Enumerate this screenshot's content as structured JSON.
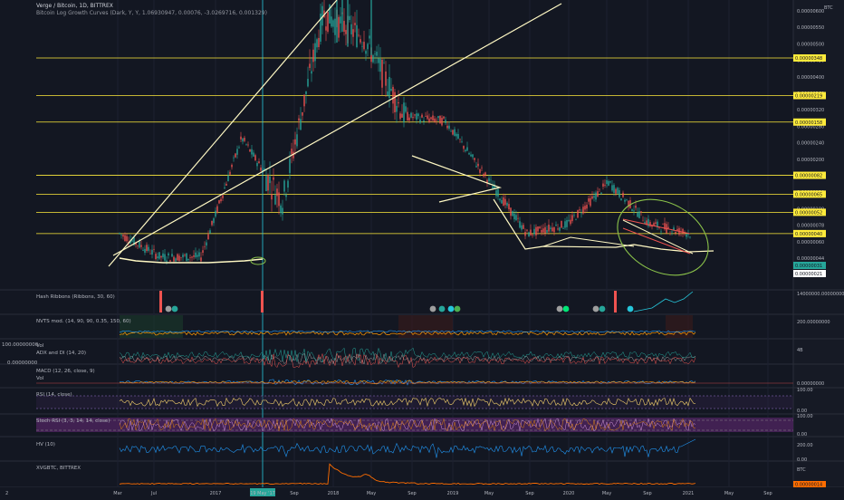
{
  "header": {
    "symbol": "Verge / Bitcoin, 1D, BITTREX",
    "indicator": "Bitcoin Log Growth Curves (Dark, Y, Y, 1.06930947, 0.00076, -3.0269716, 0.001329)",
    "currency": "BTC"
  },
  "panels": [
    {
      "name": "hash-ribbons",
      "label": "Hash Ribbons (Ribbons, 30, 60)",
      "right_value": "14000000.00000000"
    },
    {
      "name": "nvts",
      "label": "NVTS mod. (14, 90, 90, 0.35, 150, 60)",
      "right_value": "200.00000000"
    },
    {
      "name": "vol-adx",
      "label": "Vol",
      "label2": "ADX and DI (14, 20)",
      "left_top": "100.00000000",
      "left_bottom": "0.00000000",
      "right_value": "4B"
    },
    {
      "name": "macd",
      "label": "MACD (12, 26, close, 9)",
      "label2": "Vol",
      "right_value": "0.00000000"
    },
    {
      "name": "rsi",
      "label": "RSI (14, close)",
      "right_top": "100.00",
      "right_bottom": "0.00"
    },
    {
      "name": "stoch-rsi",
      "label": "Stoch RSI (3, 3, 14, 14, close)",
      "right_top": "100.00",
      "right_bottom": "0.00"
    },
    {
      "name": "hv",
      "label": "HV (10)",
      "right_top": "200.00",
      "right_bottom": "0.00"
    },
    {
      "name": "xvgbtc",
      "label": "XVGBTC, BITTREX",
      "right_top": "BTC",
      "right_bottom": "0.00000014"
    }
  ],
  "price_axis": {
    "ticks": [
      "0.00000600",
      "0.00000550",
      "0.00000500",
      "0.00000450",
      "0.00000400",
      "0.00000360",
      "0.00000320",
      "0.00000280",
      "0.00000240",
      "0.00000200",
      "0.00000160",
      "0.00000130",
      "0.00000100",
      "0.00000078",
      "0.00000060",
      "0.00000044"
    ],
    "badges": [
      {
        "text": "0.00000348",
        "color": "#ffeb3b"
      },
      {
        "text": "0.00000219",
        "color": "#ffeb3b"
      },
      {
        "text": "0.00000158",
        "color": "#ffeb3b"
      },
      {
        "text": "0.00000082",
        "color": "#ffeb3b"
      },
      {
        "text": "0.00000065",
        "color": "#ffeb3b"
      },
      {
        "text": "0.00000052",
        "color": "#ffeb3b"
      },
      {
        "text": "0.00000040",
        "color": "#ffeb3b"
      },
      {
        "text": "0.00000031",
        "color": "#26a69a"
      },
      {
        "text": "0.00000021",
        "color": "#ffffff"
      }
    ]
  },
  "time_axis": {
    "labels": [
      "Mar",
      "Jul",
      "2017",
      "19 May '17",
      "Sep",
      "2018",
      "May",
      "Sep",
      "2019",
      "May",
      "Sep",
      "2020",
      "May",
      "Sep",
      "2021",
      "May",
      "Sep"
    ],
    "highlight": "19 May '17",
    "corner_label": "2"
  },
  "colors": {
    "background": "#131722",
    "up": "#26a69a",
    "down": "#ef5350",
    "level_line": "#ffeb3b",
    "trend_line": "#fff9c4",
    "ellipse": "#8bc34a",
    "rsi": "#f5d36b",
    "stoch": "#9c27b0",
    "hv": "#2196f3",
    "xvg": "#ff6d00"
  },
  "chart_data": {
    "type": "line",
    "title": "Verge / Bitcoin, 1D, BITTREX",
    "xlabel": "",
    "ylabel": "",
    "scale": "log",
    "x": [
      "2016-03",
      "2016-07",
      "2017-01",
      "2017-05",
      "2017-09",
      "2018-01",
      "2018-05",
      "2018-09",
      "2019-01",
      "2019-05",
      "2019-09",
      "2020-01",
      "2020-05",
      "2020-09",
      "2021-01"
    ],
    "values": [
      4e-07,
      3e-07,
      3e-07,
      1.3e-06,
      6e-07,
      6e-06,
      4.5e-06,
      1.7e-06,
      1.6e-06,
      8e-07,
      4e-07,
      4.5e-07,
      7.5e-07,
      4.5e-07,
      4e-07
    ],
    "levels": [
      3.48e-06,
      2.19e-06,
      1.58e-06,
      8.2e-07,
      6.5e-07,
      5.2e-07,
      4e-07
    ],
    "ylim": [
      2.5e-07,
      6.5e-06
    ]
  }
}
